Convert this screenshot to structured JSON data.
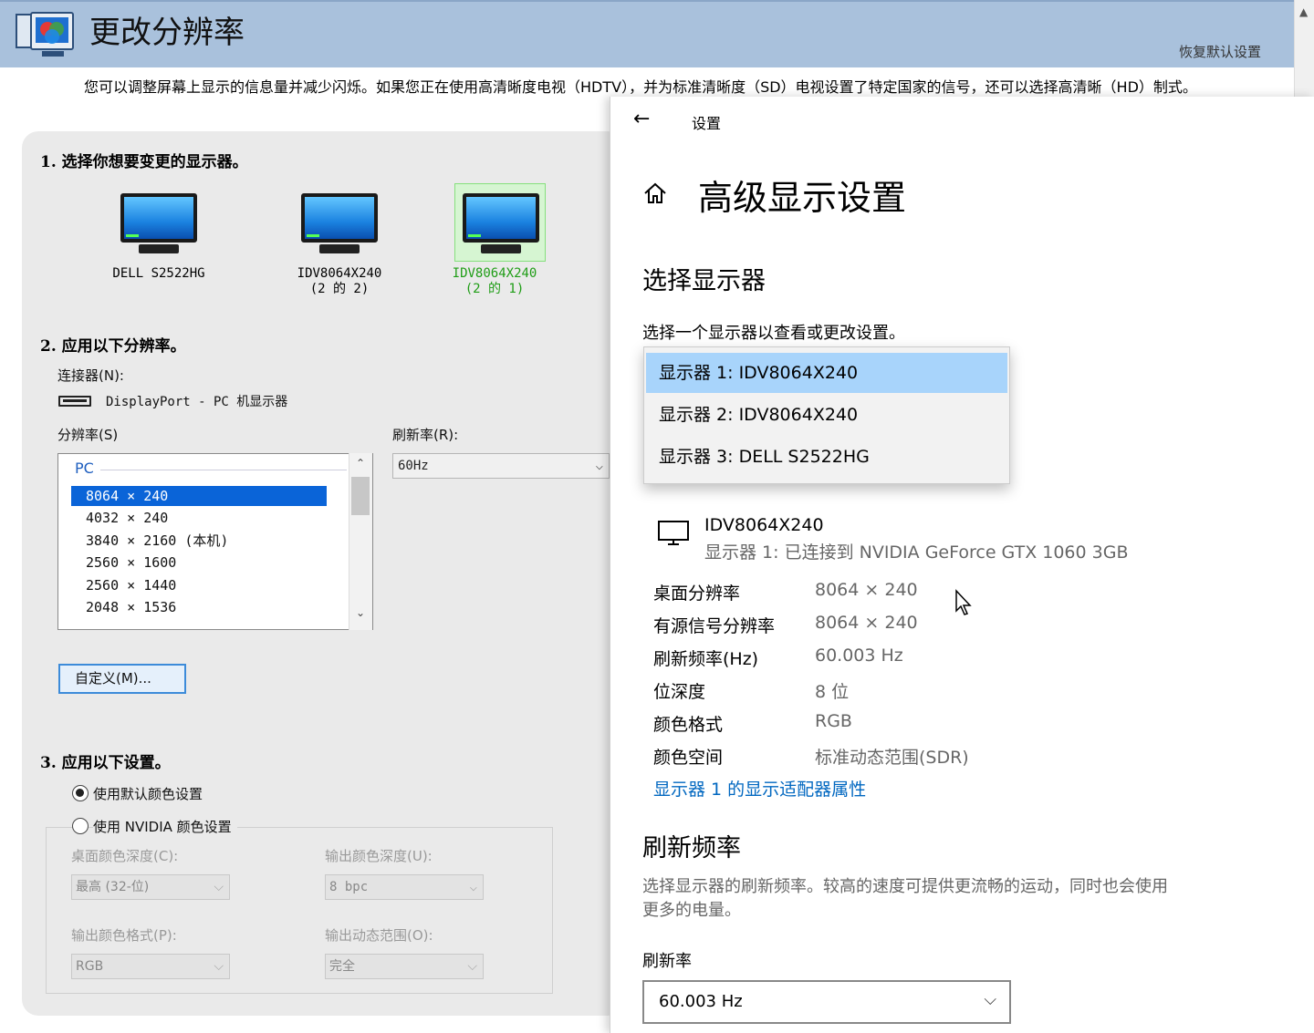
{
  "nvidia": {
    "title": "更改分辨率",
    "restore": "恢复默认设置",
    "description": "您可以调整屏幕上显示的信息量并减少闪烁。如果您正在使用高清晰度电视（HDTV），并为标准清晰度（SD）电视设置了特定国家的信号，还可以选择高清晰（HD）制式。",
    "step1": "1. 选择你想要变更的显示器。",
    "monitors": [
      {
        "line1": "DELL S2522HG",
        "line2": ""
      },
      {
        "line1": "IDV8064X240",
        "line2": "(2 的 2)"
      },
      {
        "line1": "IDV8064X240",
        "line2": "(2 的 1)"
      }
    ],
    "step2": "2. 应用以下分辨率。",
    "connector_label": "连接器(N):",
    "connector_value": "DisplayPort - PC 机显示器",
    "resolution_label": "分辨率(S)",
    "refresh_label": "刷新率(R):",
    "refresh_value": "60Hz",
    "res_group": "PC",
    "resolutions": [
      "8064 × 240",
      "4032 × 240",
      "3840 × 2160 (本机)",
      "2560 × 1600",
      "2560 × 1440",
      "2048 × 1536"
    ],
    "custom_button": "自定义(M)...",
    "step3": "3. 应用以下设置。",
    "radio_default": "使用默认颜色设置",
    "radio_nvidia": "使用 NVIDIA 颜色设置",
    "desktop_depth_label": "桌面颜色深度(C):",
    "desktop_depth_value": "最高 (32-位)",
    "output_depth_label": "输出颜色深度(U):",
    "output_depth_value": "8 bpc",
    "output_format_label": "输出颜色格式(P):",
    "output_format_value": "RGB",
    "dynamic_range_label": "输出动态范围(O):",
    "dynamic_range_value": "完全"
  },
  "settings": {
    "back_title": "设置",
    "page_title": "高级显示设置",
    "select_display_heading": "选择显示器",
    "select_display_desc": "选择一个显示器以查看或更改设置。",
    "dropdown_items": [
      "显示器 1: IDV8064X240",
      "显示器 2: IDV8064X240",
      "显示器 3: DELL S2522HG"
    ],
    "display_name": "IDV8064X240",
    "display_sub": "显示器 1: 已连接到 NVIDIA GeForce GTX 1060 3GB",
    "info": [
      {
        "label": "桌面分辨率",
        "value": "8064 × 240"
      },
      {
        "label": "有源信号分辨率",
        "value": "8064 × 240"
      },
      {
        "label": "刷新频率(Hz)",
        "value": "60.003 Hz"
      },
      {
        "label": "位深度",
        "value": "8 位"
      },
      {
        "label": "颜色格式",
        "value": "RGB"
      },
      {
        "label": "颜色空间",
        "value": "标准动态范围(SDR)"
      }
    ],
    "adapter_link": "显示器 1 的显示适配器属性",
    "refresh_heading": "刷新频率",
    "refresh_desc1": "选择显示器的刷新频率。较高的速度可提供更流畅的运动，同时也会使用",
    "refresh_desc2": "更多的电量。",
    "refresh_label": "刷新率",
    "refresh_value": "60.003 Hz"
  },
  "colors": {
    "accent": "#0067c0",
    "nv_header": "#a9c1dc",
    "selection": "#0078d7"
  }
}
